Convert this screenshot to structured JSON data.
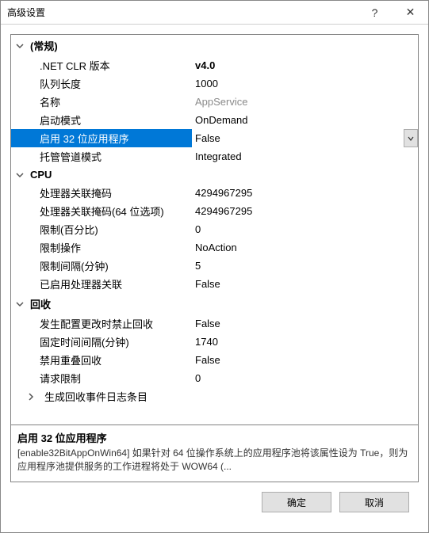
{
  "window": {
    "title": "高级设置",
    "help": "?",
    "close": "✕"
  },
  "sections": {
    "general": {
      "title": "(常规)",
      "rows": {
        "clr": {
          "label": ".NET CLR 版本",
          "value": "v4.0"
        },
        "queue": {
          "label": "队列长度",
          "value": "1000"
        },
        "name": {
          "label": "名称",
          "value": "AppService"
        },
        "startmode": {
          "label": "启动模式",
          "value": "OnDemand"
        },
        "enable32": {
          "label": "启用 32 位应用程序",
          "value": "False"
        },
        "pipeline": {
          "label": "托管管道模式",
          "value": "Integrated"
        }
      }
    },
    "cpu": {
      "title": "CPU",
      "rows": {
        "affinity": {
          "label": "处理器关联掩码",
          "value": "4294967295"
        },
        "affinity64": {
          "label": "处理器关联掩码(64 位选项)",
          "value": "4294967295"
        },
        "limitpct": {
          "label": "限制(百分比)",
          "value": "0"
        },
        "limitaction": {
          "label": "限制操作",
          "value": "NoAction"
        },
        "limitinterval": {
          "label": "限制间隔(分钟)",
          "value": "5"
        },
        "affinityenabled": {
          "label": "已启用处理器关联",
          "value": "False"
        }
      }
    },
    "recycle": {
      "title": "回收",
      "rows": {
        "disallowrot": {
          "label": "发生配置更改时禁止回收",
          "value": "False"
        },
        "periodic": {
          "label": "固定时间间隔(分钟)",
          "value": "1740"
        },
        "overlap": {
          "label": "禁用重叠回收",
          "value": "False"
        },
        "requestlimit": {
          "label": "请求限制",
          "value": "0"
        },
        "logevent": {
          "label": "生成回收事件日志条目",
          "value": ""
        }
      }
    }
  },
  "description": {
    "title": "启用 32 位应用程序",
    "text": "[enable32BitAppOnWin64] 如果针对 64 位操作系统上的应用程序池将该属性设为 True，则为应用程序池提供服务的工作进程将处于 WOW64 (..."
  },
  "buttons": {
    "ok": "确定",
    "cancel": "取消"
  }
}
